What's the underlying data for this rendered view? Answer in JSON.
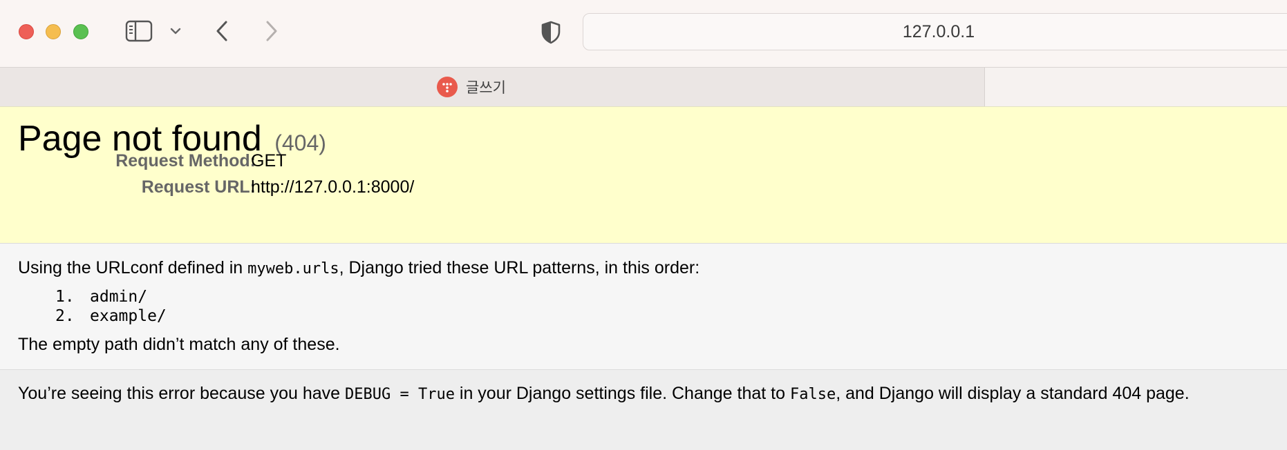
{
  "browser": {
    "url": "127.0.0.1",
    "tab": {
      "title": "글쓰기"
    }
  },
  "summary": {
    "title": "Page not found",
    "status_code": "(404)",
    "request_method_label": "Request Method:",
    "request_method": "GET",
    "request_url_label": "Request URL:",
    "request_url": "http://127.0.0.1:8000/"
  },
  "info": {
    "intro_before": "Using the URLconf defined in ",
    "urlconf": "myweb.urls",
    "intro_after": ", Django tried these URL patterns, in this order:",
    "patterns": [
      {
        "number": "1.",
        "pattern": "admin/"
      },
      {
        "number": "2.",
        "pattern": "example/"
      }
    ],
    "no_match": "The empty path didn’t match any of these."
  },
  "explanation": {
    "part1": "You’re seeing this error because you have ",
    "debug_code": "DEBUG = True",
    "part2": " in your Django settings file. Change that to ",
    "false_code": "False",
    "part3": ", and Django will display a standard 404 page."
  },
  "colors": {
    "summary_bg": "#ffffcc",
    "info_bg": "#f6f6f6",
    "explanation_bg": "#eeeeee",
    "traffic_red": "#ee5f57",
    "traffic_yellow": "#f5bd4f",
    "traffic_green": "#5ac051",
    "favicon": "#e95a4c"
  },
  "icons": [
    "close-window-icon",
    "minimize-window-icon",
    "zoom-window-icon",
    "sidebar-icon",
    "chevron-down-icon",
    "back-icon",
    "forward-icon",
    "privacy-shield-icon",
    "favicon-icon"
  ]
}
